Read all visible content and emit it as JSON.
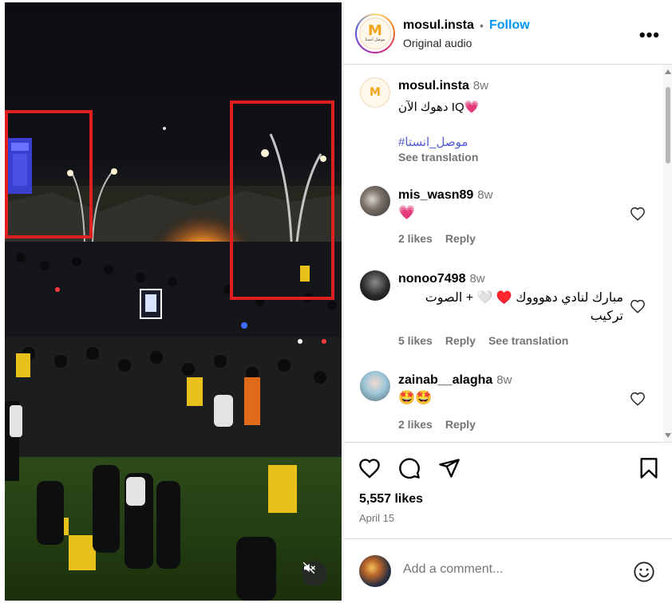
{
  "header": {
    "username": "mosul.insta",
    "separator": "•",
    "follow_label": "Follow",
    "audio_label": "Original audio",
    "more_label": "•••",
    "logo_mark": "M",
    "logo_sub": "موصل انستا"
  },
  "caption": {
    "username": "mosul.insta",
    "time": "8w",
    "text": "دهوك الآن IQ💗",
    "hashtag": "#موصل_انستا",
    "translation": "See translation"
  },
  "comments": [
    {
      "username": "mis_wasn89",
      "time": "8w",
      "text": "💗",
      "likes": "2 likes",
      "reply": "Reply"
    },
    {
      "username": "nonoo7498",
      "time": "8w",
      "text_line1": "مبارك لنادي دهوووك ♥️ 🤍 + الصوت",
      "text_line2": "تركيب",
      "likes": "5 likes",
      "reply": "Reply",
      "translation": "See translation"
    },
    {
      "username": "zainab__alagha",
      "time": "8w",
      "text": "🤩🤩",
      "likes": "2 likes",
      "reply": "Reply"
    }
  ],
  "stats": {
    "likes": "5,557 likes",
    "date": "April 15"
  },
  "add_comment": {
    "placeholder": "Add a comment..."
  },
  "icons": {
    "like": "heart-icon",
    "comment": "comment-icon",
    "share": "share-icon",
    "save": "bookmark-icon",
    "emoji": "emoji-icon",
    "mute": "muted-speaker-icon"
  },
  "colors": {
    "follow": "#0095f6",
    "muted_text": "#737373",
    "highlight_box": "#e02020"
  }
}
